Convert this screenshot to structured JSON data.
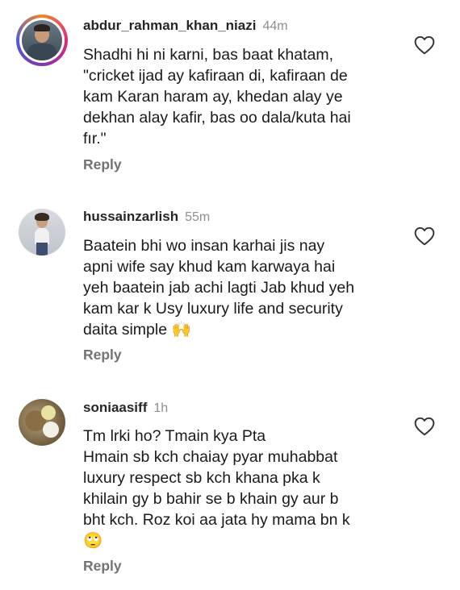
{
  "comments": [
    {
      "username": "abdur_rahman_khan_niazi",
      "time": "44m",
      "text": "Shadhi hi ni karni, bas baat khatam,\n\"cricket ijad ay kafiraan di, kafiraan de\nkam Karan haram ay, khedan alay ye\ndekhan alay kafir, bas oo dala/kuta hai\nfır.\"",
      "reply_label": "Reply"
    },
    {
      "username": "hussainzarlish",
      "time": "55m",
      "text": "Baatein bhi wo insan karhai jis nay\napni wife say khud kam karwaya hai\nyeh baatein jab achi lagti Jab khud yeh\nkam kar k Usy luxury life and security\ndaita simple 🙌",
      "reply_label": "Reply"
    },
    {
      "username": "soniaasiff",
      "time": "1h",
      "text": "Tm lrki ho? Tmain kya Pta\nHmain sb kch chaiay pyar muhabbat\nluxury respect sb kch khana pka k\nkhilain gy b bahir se b khain gy aur b\nbht kch. Roz koi aa jata hy mama bn k\n🙄",
      "reply_label": "Reply"
    }
  ],
  "icons": {
    "like": "heart-outline-icon"
  },
  "colors": {
    "username": "#262626",
    "meta": "#8e8e8e",
    "reply": "#737373"
  }
}
